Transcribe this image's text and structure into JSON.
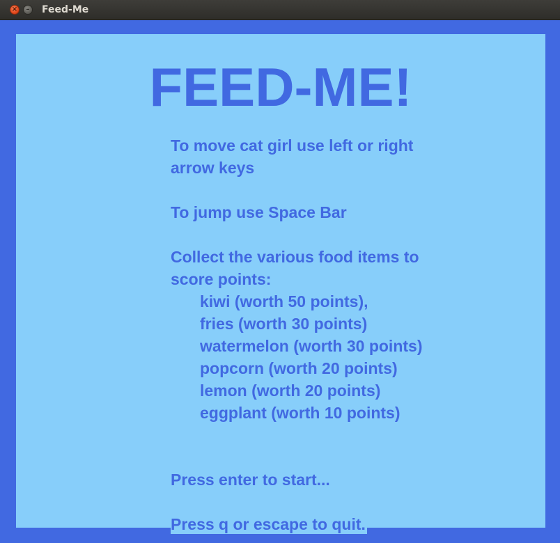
{
  "window": {
    "title": "Feed-Me",
    "close_glyph": "×",
    "minimize_glyph": "–"
  },
  "colors": {
    "border": "#4169e1",
    "panel": "#87cefa",
    "text": "#4169e1"
  },
  "screen": {
    "title": "FEED-ME!",
    "move_line_1": "To move cat girl use left or right",
    "move_line_2": "arrow keys",
    "jump_line": "To jump use Space Bar",
    "collect_line_1": "Collect the various food items to",
    "collect_line_2": "score points:",
    "food_items": [
      "kiwi (worth 50 points),",
      "fries (worth 30 points)",
      "watermelon (worth 30 points)",
      "popcorn (worth 20 points)",
      "lemon (worth 20 points)",
      "eggplant (worth 10 points)"
    ],
    "start_prompt": "Press enter to start...",
    "quit_prompt": "Press q or escape to quit."
  }
}
